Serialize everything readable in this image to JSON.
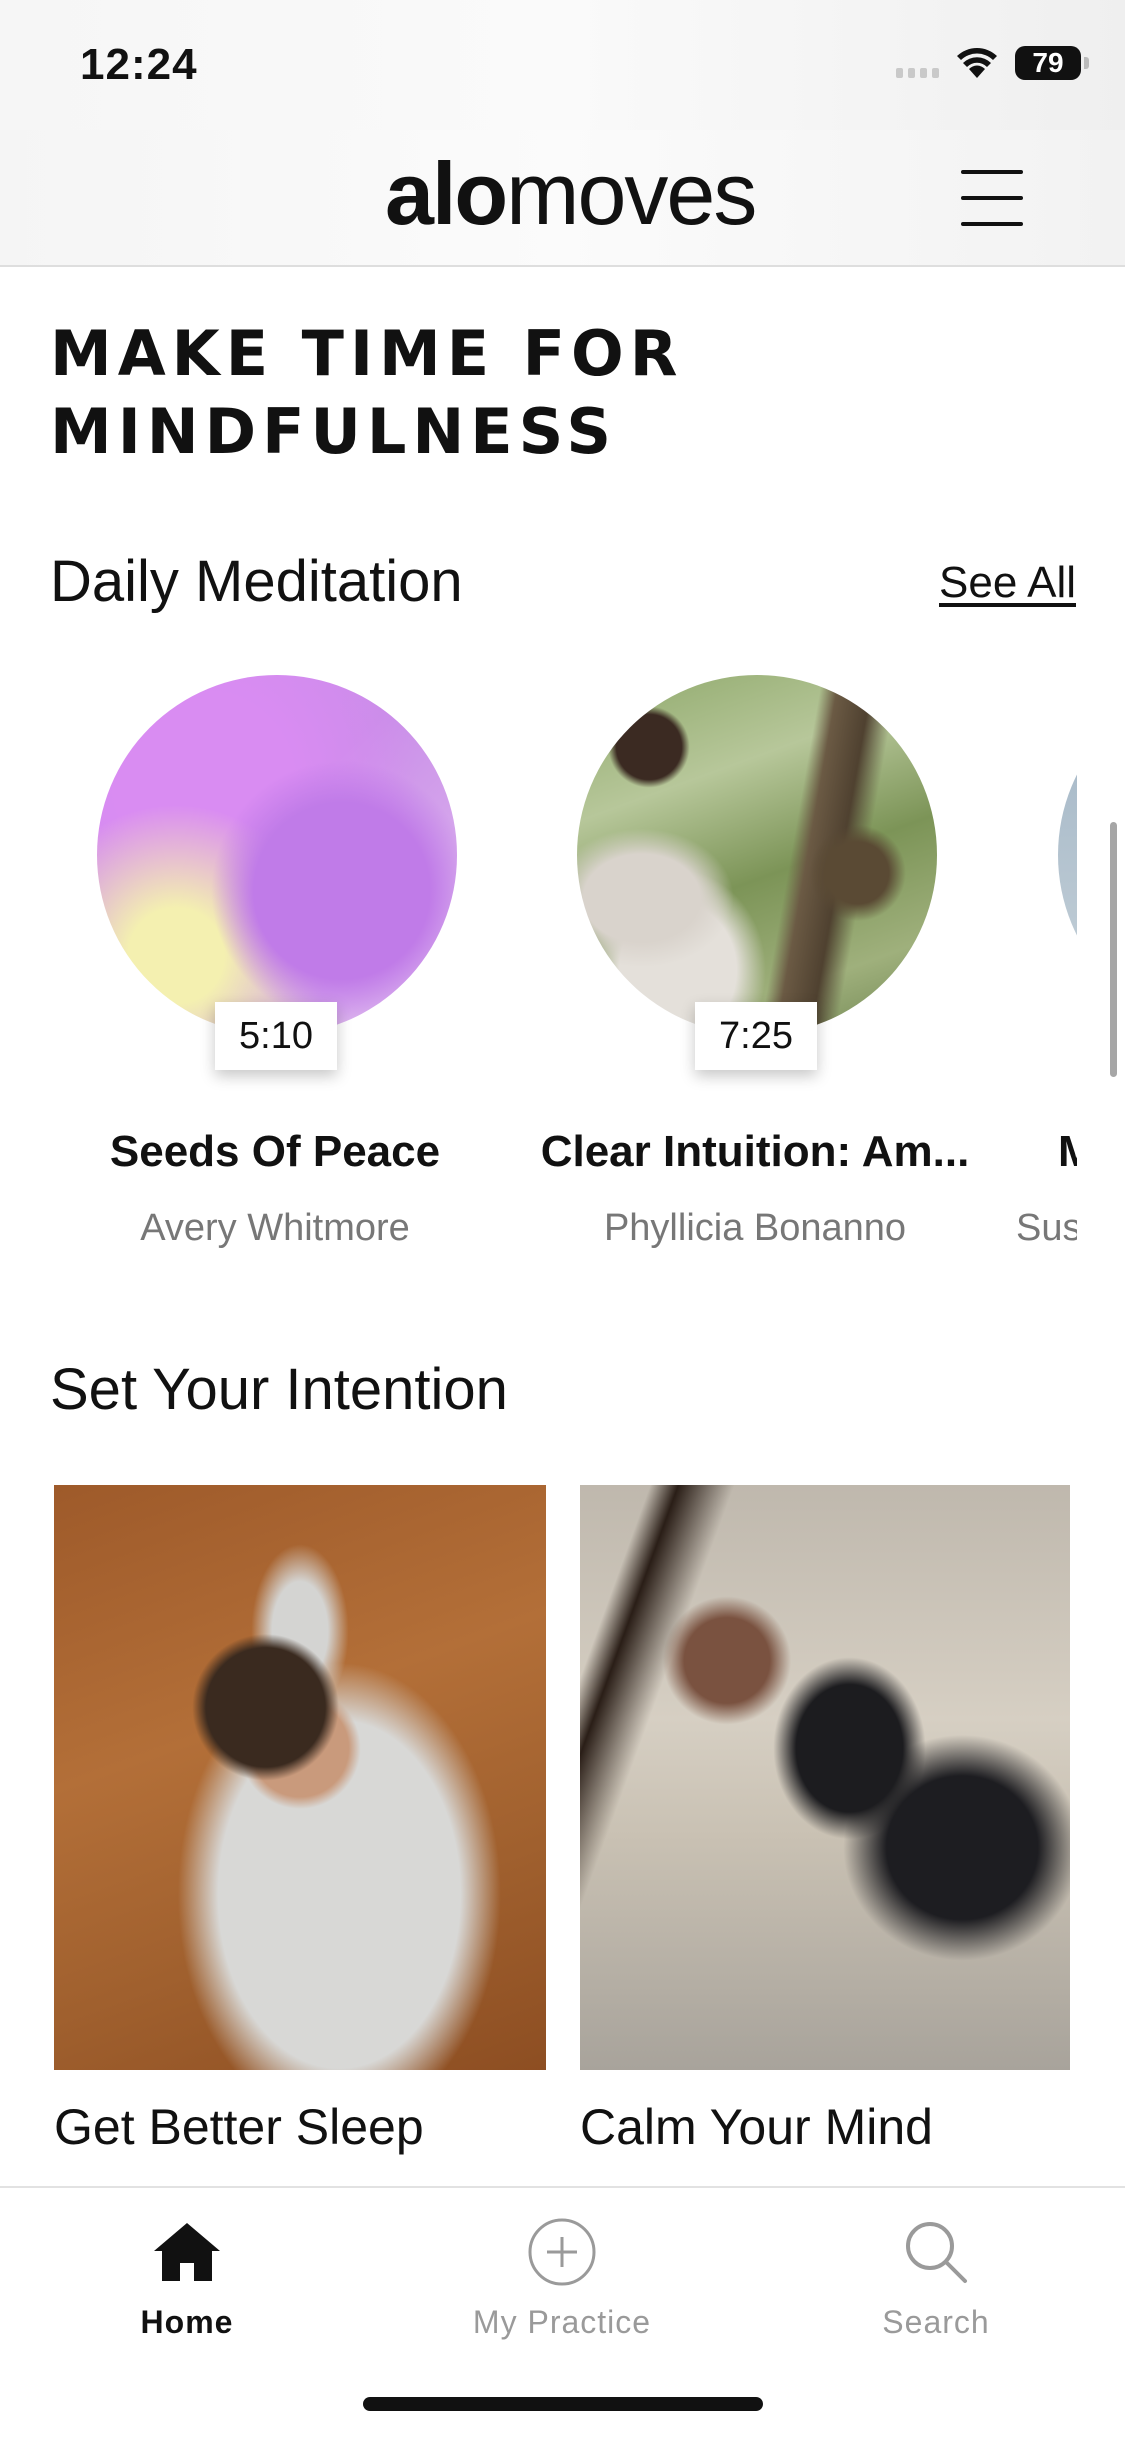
{
  "status_bar": {
    "time": "12:24",
    "battery": "79"
  },
  "header": {
    "logo_bold": "alo",
    "logo_light": "moves"
  },
  "headline": "MAKE TIME FOR MINDFULNESS",
  "daily_meditation": {
    "title": "Daily Meditation",
    "see_all": "See All",
    "items": [
      {
        "duration": "5:10",
        "title": "Seeds Of Peace",
        "author": "Avery Whitmore"
      },
      {
        "duration": "7:25",
        "title": "Clear Intuition: Am...",
        "author": "Phyllicia Bonanno"
      },
      {
        "duration": "",
        "title": "M",
        "author": "Sus"
      }
    ]
  },
  "set_intention": {
    "title": "Set Your Intention",
    "items": [
      {
        "title": "Get Better Sleep"
      },
      {
        "title": "Calm Your Mind"
      }
    ]
  },
  "tab_bar": {
    "tabs": [
      {
        "label": "Home",
        "icon": "home-icon",
        "active": true
      },
      {
        "label": "My Practice",
        "icon": "plus-circle-icon",
        "active": false
      },
      {
        "label": "Search",
        "icon": "search-icon",
        "active": false
      }
    ]
  }
}
